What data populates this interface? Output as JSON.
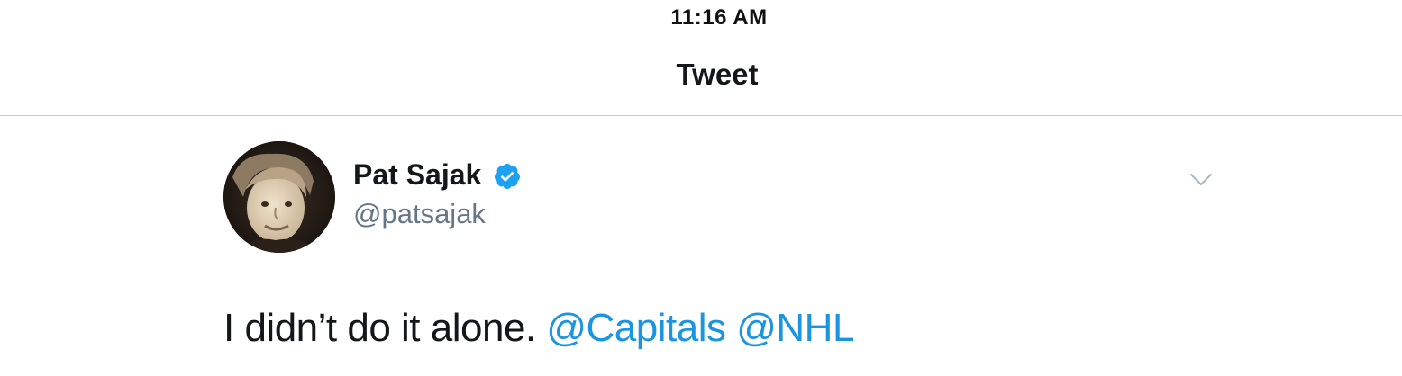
{
  "status_bar": {
    "time": "11:16 AM"
  },
  "nav": {
    "title": "Tweet"
  },
  "tweet": {
    "author": {
      "display_name": "Pat Sajak",
      "handle": "@patsajak",
      "verified": true,
      "verified_icon": "verified-badge-icon",
      "avatar_icon": "profile-photo"
    },
    "menu_icon": "chevron-down-icon",
    "text_plain": "I didn’t do it alone. ",
    "mentions": [
      "@Capitals",
      "@NHL"
    ]
  },
  "colors": {
    "text_primary": "#14171a",
    "text_secondary": "#657786",
    "link": "#1b95e0",
    "verified": "#1da1f2",
    "divider": "#c8ccd0"
  }
}
